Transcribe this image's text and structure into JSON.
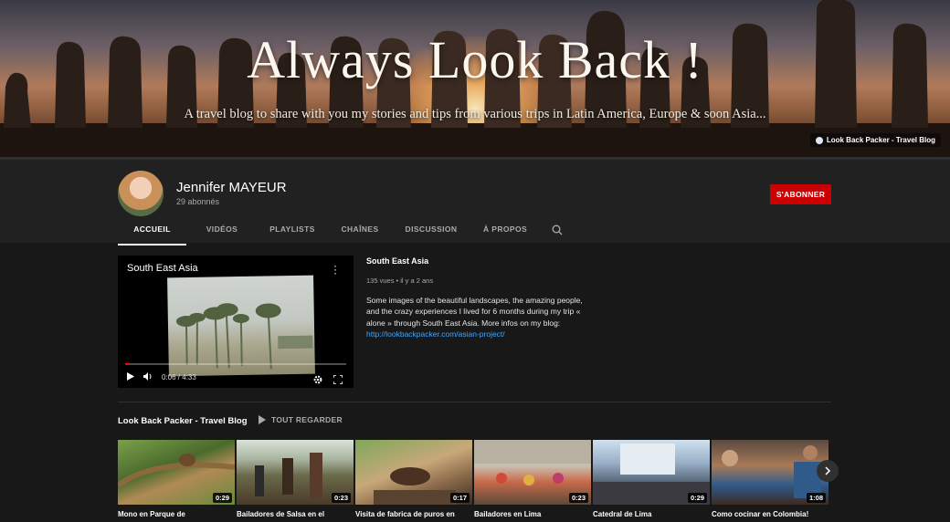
{
  "banner": {
    "title": "Always Look Back !",
    "subtitle": "A travel blog to share with you my stories and tips from various trips in Latin America, Europe & soon Asia...",
    "link_label": "Look Back Packer - Travel Blog"
  },
  "channel": {
    "name": "Jennifer MAYEUR",
    "subscribers": "29 abonnés",
    "subscribe_label": "S'ABONNER"
  },
  "tabs": [
    {
      "label": "ACCUEIL",
      "active": true
    },
    {
      "label": "VIDÉOS",
      "active": false
    },
    {
      "label": "PLAYLISTS",
      "active": false
    },
    {
      "label": "CHAÎNES",
      "active": false
    },
    {
      "label": "DISCUSSION",
      "active": false
    },
    {
      "label": "À PROPOS",
      "active": false
    }
  ],
  "featured": {
    "player_title": "South East Asia",
    "time": "0:06 / 4:33",
    "progress": 0.022,
    "title": "South East Asia",
    "meta": "135 vues • il y a 2 ans",
    "description": "Some images of the beautiful landscapes, the amazing people, and the crazy experiences I lived for 6 months during my trip « alone » through South East Asia. More infos on my blog: ",
    "link": "http://lookbackpacker.com/asian-project/"
  },
  "shelf": {
    "title": "Look Back Packer - Travel Blog",
    "play_all_label": "TOUT REGARDER",
    "videos": [
      {
        "title": "Mono en Parque de",
        "duration": "0:29"
      },
      {
        "title": "Bailadores de Salsa en el",
        "duration": "0:23"
      },
      {
        "title": "Visita de fabrica de puros en",
        "duration": "0:17"
      },
      {
        "title": "Bailadores en Lima",
        "duration": "0:23"
      },
      {
        "title": "Catedral de Lima",
        "duration": "0:29"
      },
      {
        "title": "Como cocinar en Colombia!",
        "duration": "1:08"
      }
    ]
  },
  "colors": {
    "accent": "#cc0000",
    "link": "#3ea6ff",
    "background": "#181818",
    "header": "#212121"
  },
  "icons": [
    "globe-icon",
    "search-icon",
    "more-vert-icon",
    "play-icon",
    "volume-icon",
    "settings-icon",
    "fullscreen-icon",
    "play-all-icon",
    "chevron-right-icon"
  ]
}
